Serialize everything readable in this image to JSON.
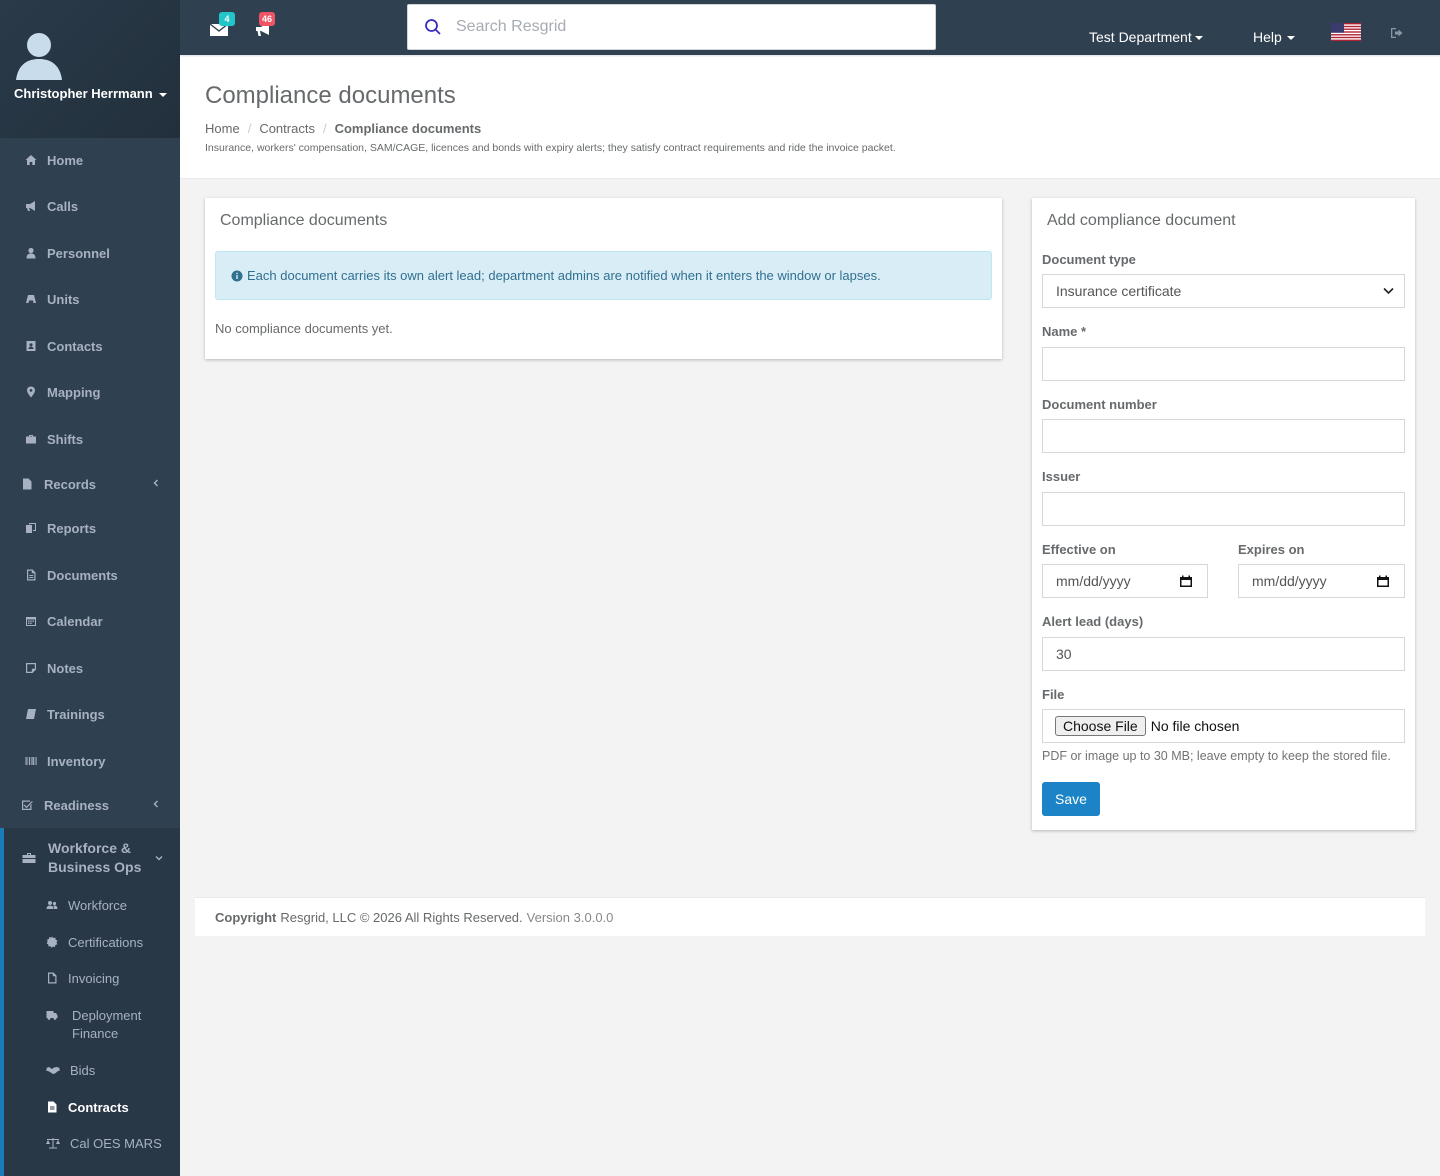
{
  "user": {
    "name": "Christopher Herrmann"
  },
  "sidebar": {
    "items": [
      {
        "label": "Home",
        "icon": "home-icon"
      },
      {
        "label": "Calls",
        "icon": "bullhorn-icon"
      },
      {
        "label": "Personnel",
        "icon": "user-icon"
      },
      {
        "label": "Units",
        "icon": "truck-icon"
      },
      {
        "label": "Contacts",
        "icon": "address-book-icon"
      },
      {
        "label": "Mapping",
        "icon": "map-marker-icon"
      },
      {
        "label": "Shifts",
        "icon": "briefcase-icon"
      },
      {
        "label": "Records",
        "icon": "file-icon"
      },
      {
        "label": "Reports",
        "icon": "report-icon"
      },
      {
        "label": "Documents",
        "icon": "document-icon"
      },
      {
        "label": "Calendar",
        "icon": "calendar-icon"
      },
      {
        "label": "Notes",
        "icon": "sticky-note-icon"
      },
      {
        "label": "Trainings",
        "icon": "book-icon"
      },
      {
        "label": "Inventory",
        "icon": "barcode-icon"
      },
      {
        "label": "Readiness",
        "icon": "check-square-icon"
      }
    ],
    "group": {
      "label_line1": "Workforce &",
      "label_line2": "Business Ops",
      "icon": "toolbox-icon",
      "children": [
        {
          "label": "Workforce",
          "icon": "users-icon"
        },
        {
          "label": "Certifications",
          "icon": "certificate-icon"
        },
        {
          "label": "Invoicing",
          "icon": "invoice-icon"
        },
        {
          "label": "Deployment Finance",
          "icon": "truck-icon"
        },
        {
          "label": "Bids",
          "icon": "handshake-icon"
        },
        {
          "label": "Contracts",
          "icon": "contract-icon"
        },
        {
          "label": "Cal OES MARS",
          "icon": "balance-scale-icon"
        }
      ]
    }
  },
  "topbar": {
    "messages_count": "4",
    "calls_count": "46",
    "search_placeholder": "Search Resgrid",
    "department": "Test Department",
    "help": "Help",
    "colors": {
      "messages_badge": "#23c6c8",
      "calls_badge": "#ed5565"
    }
  },
  "page": {
    "title": "Compliance documents",
    "breadcrumb": [
      "Home",
      "Contracts",
      "Compliance documents"
    ],
    "subtitle": "Insurance, workers' compensation, SAM/CAGE, licences and bonds with expiry alerts; they satisfy contract requirements and ride the invoice packet."
  },
  "list_panel": {
    "title": "Compliance documents",
    "info": "Each document carries its own alert lead; department admins are notified when it enters the window or lapses.",
    "empty": "No compliance documents yet."
  },
  "form": {
    "title": "Add compliance document",
    "document_type_label": "Document type",
    "document_type_value": "Insurance certificate",
    "name_label": "Name *",
    "name_value": "",
    "number_label": "Document number",
    "number_value": "",
    "issuer_label": "Issuer",
    "issuer_value": "",
    "effective_label": "Effective on",
    "effective_value": "mm/dd/yyyy",
    "expires_label": "Expires on",
    "expires_value": "mm/dd/yyyy",
    "alert_lead_label": "Alert lead (days)",
    "alert_lead_value": "30",
    "file_label": "File",
    "choose_file": "Choose File",
    "no_file": "No file chosen",
    "file_help": "PDF or image up to 30 MB; leave empty to keep the stored file.",
    "save": "Save"
  },
  "footer": {
    "copyright": "Copyright",
    "text": "Resgrid, LLC © 2026 All Rights Reserved.",
    "version": "Version 3.0.0.0"
  }
}
